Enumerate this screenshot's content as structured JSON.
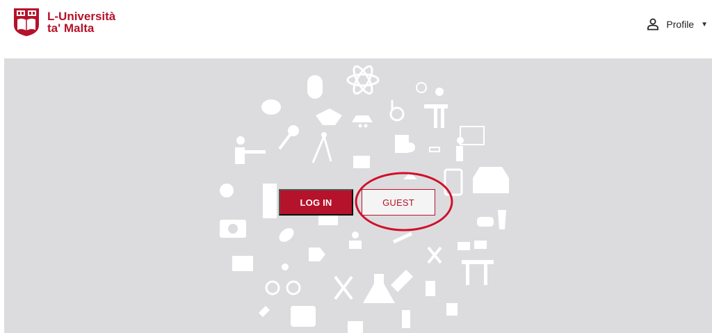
{
  "brand": {
    "name_line1": "L-Università",
    "name_line2": "ta' Malta",
    "color": "#b5122b"
  },
  "header": {
    "profile_label": "Profile",
    "profile_icon": "person-icon",
    "profile_caret_icon": "chevron-down-icon"
  },
  "hero": {
    "background": "#dcdcde",
    "login_label": "LOG IN",
    "guest_label": "GUEST",
    "annotation_color": "#d0102a"
  }
}
